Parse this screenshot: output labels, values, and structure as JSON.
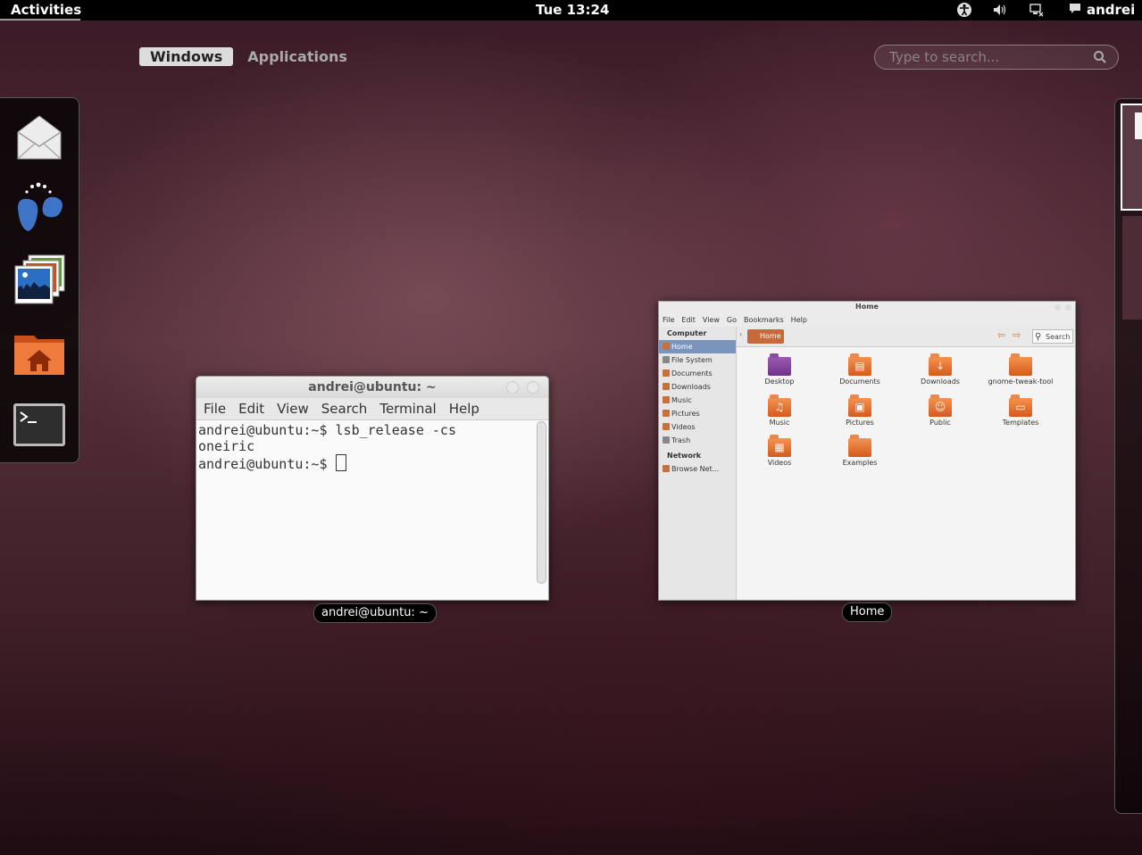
{
  "topbar": {
    "activities": "Activities",
    "clock": "Tue 13:24",
    "user": "andrei",
    "tray_icons": [
      "accessibility-icon",
      "volume-icon",
      "network-icon",
      "chat-icon"
    ]
  },
  "overview": {
    "tabs": [
      {
        "label": "Windows",
        "active": true
      },
      {
        "label": "Applications",
        "active": false
      }
    ],
    "search_placeholder": "Type to search..."
  },
  "dash": {
    "items": [
      "mail-icon",
      "empathy-icon",
      "image-viewer-icon",
      "home-folder-icon",
      "terminal-icon"
    ]
  },
  "windows": {
    "terminal": {
      "title": "andrei@ubuntu: ~",
      "menu": [
        "File",
        "Edit",
        "View",
        "Search",
        "Terminal",
        "Help"
      ],
      "lines": [
        "andrei@ubuntu:~$ lsb_release -cs",
        "oneiric",
        "andrei@ubuntu:~$ "
      ],
      "caption": "andrei@ubuntu: ~"
    },
    "nautilus": {
      "title": "Home",
      "menu": [
        "File",
        "Edit",
        "View",
        "Go",
        "Bookmarks",
        "Help"
      ],
      "sidebar": {
        "computer_header": "Computer",
        "computer_items": [
          "Home",
          "File System",
          "Documents",
          "Downloads",
          "Music",
          "Pictures",
          "Videos",
          "Trash"
        ],
        "network_header": "Network",
        "network_items": [
          "Browse Net..."
        ]
      },
      "breadcrumb": "Home",
      "search_label": "Search",
      "files": [
        "Desktop",
        "Documents",
        "Downloads",
        "gnome-tweak-tool",
        "Music",
        "Pictures",
        "Public",
        "Templates",
        "Videos",
        "Examples"
      ],
      "caption": "Home"
    }
  },
  "colors": {
    "accent_selection": "#7a95bd",
    "folder_orange": "#d45a1f"
  }
}
